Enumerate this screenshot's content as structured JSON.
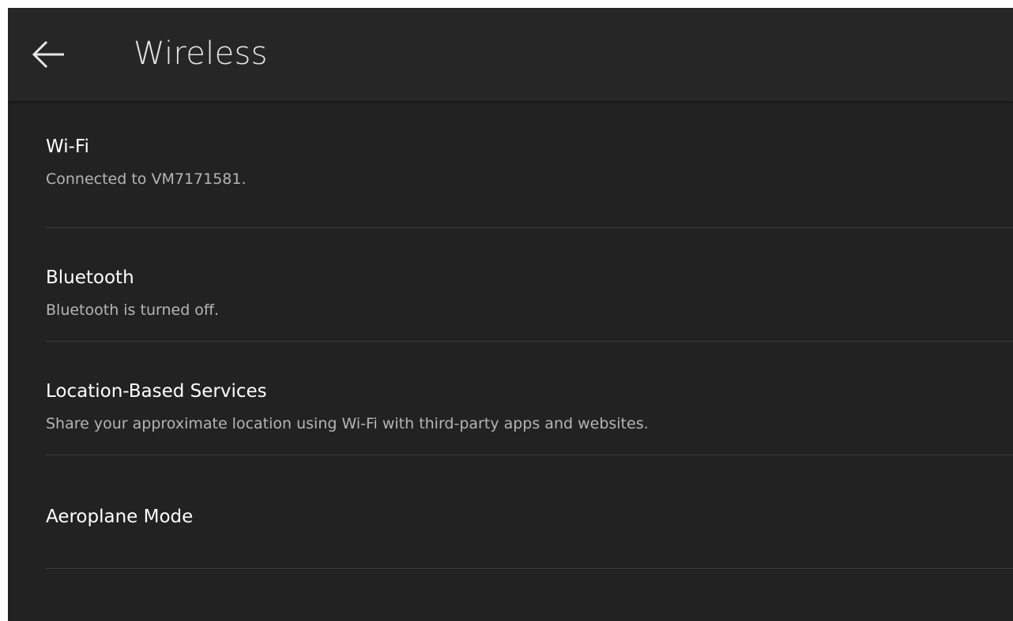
{
  "header": {
    "title": "Wireless"
  },
  "settings": {
    "items": [
      {
        "title": "Wi-Fi",
        "subtitle": "Connected to VM7171581."
      },
      {
        "title": "Bluetooth",
        "subtitle": "Bluetooth is turned off."
      },
      {
        "title": "Location-Based Services",
        "subtitle": "Share your approximate location using Wi-Fi with third-party apps and websites."
      },
      {
        "title": "Aeroplane Mode"
      }
    ]
  },
  "colors": {
    "background": "#222222",
    "header_background": "#262626",
    "title_text": "#ffffff",
    "subtitle_text": "#b5b5b5",
    "divider": "#3c3c3c"
  },
  "icons": {
    "back": "arrow-left-icon"
  }
}
